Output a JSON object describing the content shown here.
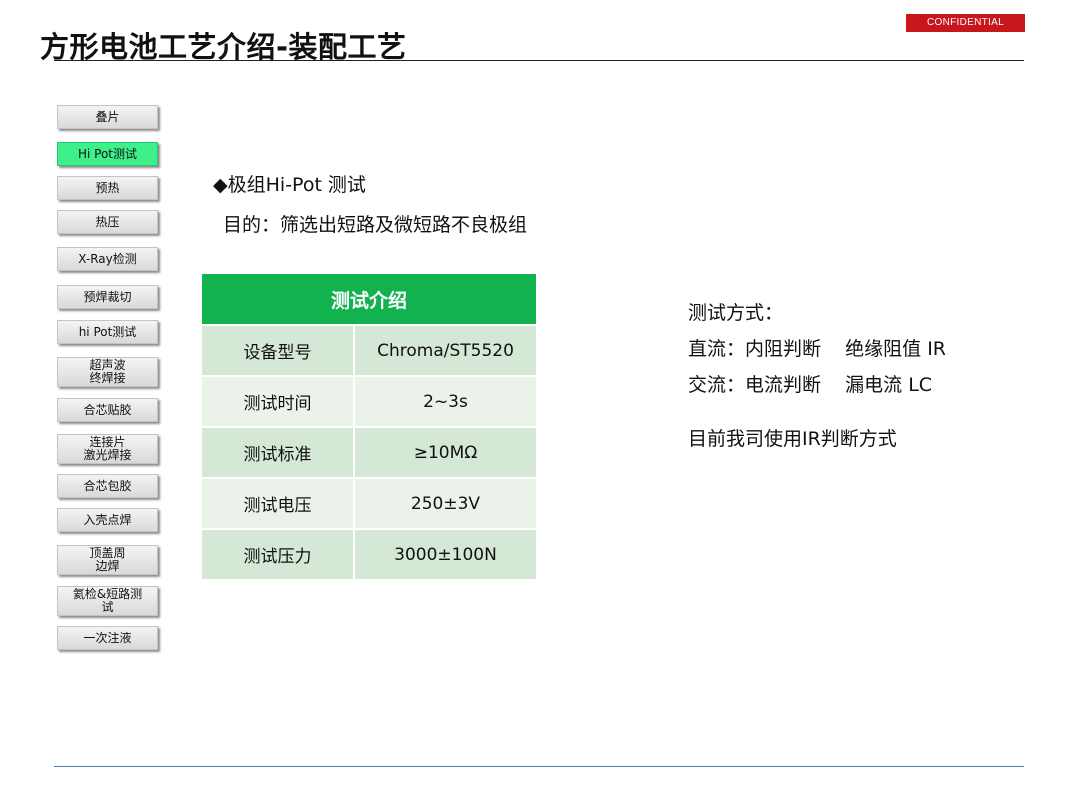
{
  "header": {
    "title": "方形电池工艺介绍-装配工艺",
    "confidential": "CONFIDENTIAL"
  },
  "sidebar": {
    "items": [
      {
        "label": "叠片",
        "active": false
      },
      {
        "label": "Hi Pot测试",
        "active": true
      },
      {
        "label": "预热",
        "active": false
      },
      {
        "label": "热压",
        "active": false
      },
      {
        "label": "X-Ray检测",
        "active": false
      },
      {
        "label": "预焊裁切",
        "active": false
      },
      {
        "label": "hi Pot测试",
        "active": false
      },
      {
        "label": "超声波\n终焊接",
        "active": false
      },
      {
        "label": "合芯贴胶",
        "active": false
      },
      {
        "label": "连接片\n激光焊接",
        "active": false
      },
      {
        "label": "合芯包胶",
        "active": false
      },
      {
        "label": "入壳点焊",
        "active": false
      },
      {
        "label": "顶盖周\n边焊",
        "active": false
      },
      {
        "label": "氦检&短路测\n试",
        "active": false
      },
      {
        "label": "一次注液",
        "active": false
      }
    ]
  },
  "main": {
    "heading": "◆极组Hi-Pot 测试",
    "purpose": "目的：筛选出短路及微短路不良极组",
    "table": {
      "header": "测试介绍",
      "rows": [
        {
          "label": "设备型号",
          "value": "Chroma/ST5520"
        },
        {
          "label": "测试时间",
          "value": "2~3s"
        },
        {
          "label": "测试标准",
          "value": "≥10MΩ"
        },
        {
          "label": "测试电压",
          "value": "250±3V"
        },
        {
          "label": "测试压力",
          "value": "3000±100N"
        }
      ]
    },
    "method": {
      "title": "测试方式：",
      "dc": "直流：内阻判断    绝缘阻值 IR",
      "ac": "交流：电流判断    漏电流 LC",
      "current": "目前我司使用IR判断方式"
    }
  },
  "colors": {
    "accent_green": "#12b24f",
    "active_green": "#3ef08a",
    "confidential_red": "#c8161d",
    "footer_blue": "#4a7db8"
  }
}
